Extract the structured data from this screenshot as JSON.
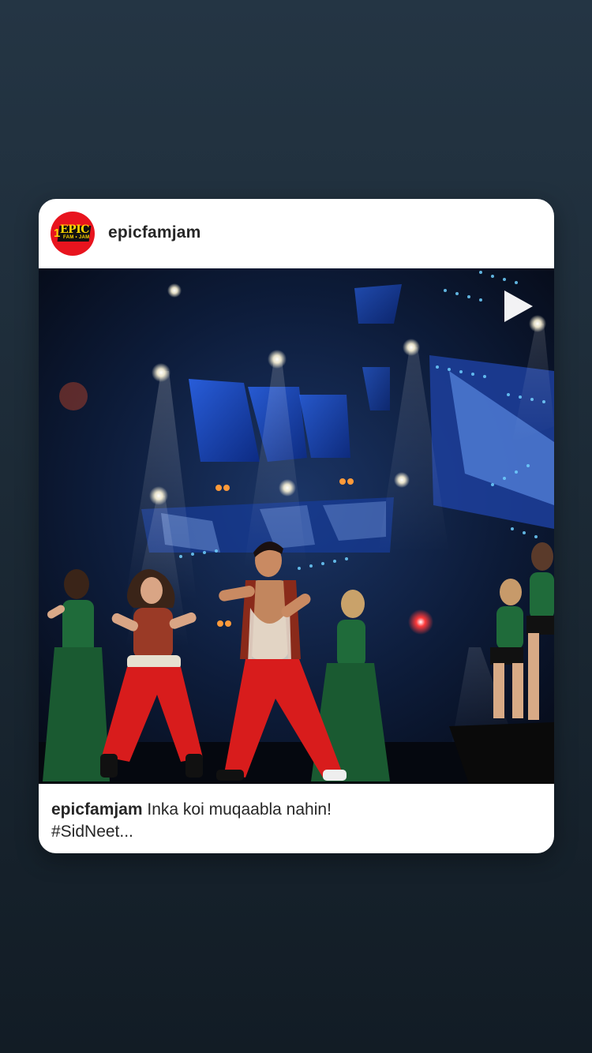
{
  "story": {
    "background_top": "#243544",
    "background_bottom": "#121c25"
  },
  "post": {
    "username": "epicfamjam",
    "avatar": {
      "icon": "epic-famjam-logo",
      "color": "#e8141e",
      "logo_text": "EPIC",
      "logo_sub": "FAM • JAM",
      "logo_number": "1"
    },
    "media": {
      "type": "video",
      "icon": "play-icon",
      "description_hidden": true
    },
    "caption": {
      "username": "epicfamjam",
      "text": "Inka koi muqaabla nahin!",
      "more": "#SidNeet..."
    }
  }
}
